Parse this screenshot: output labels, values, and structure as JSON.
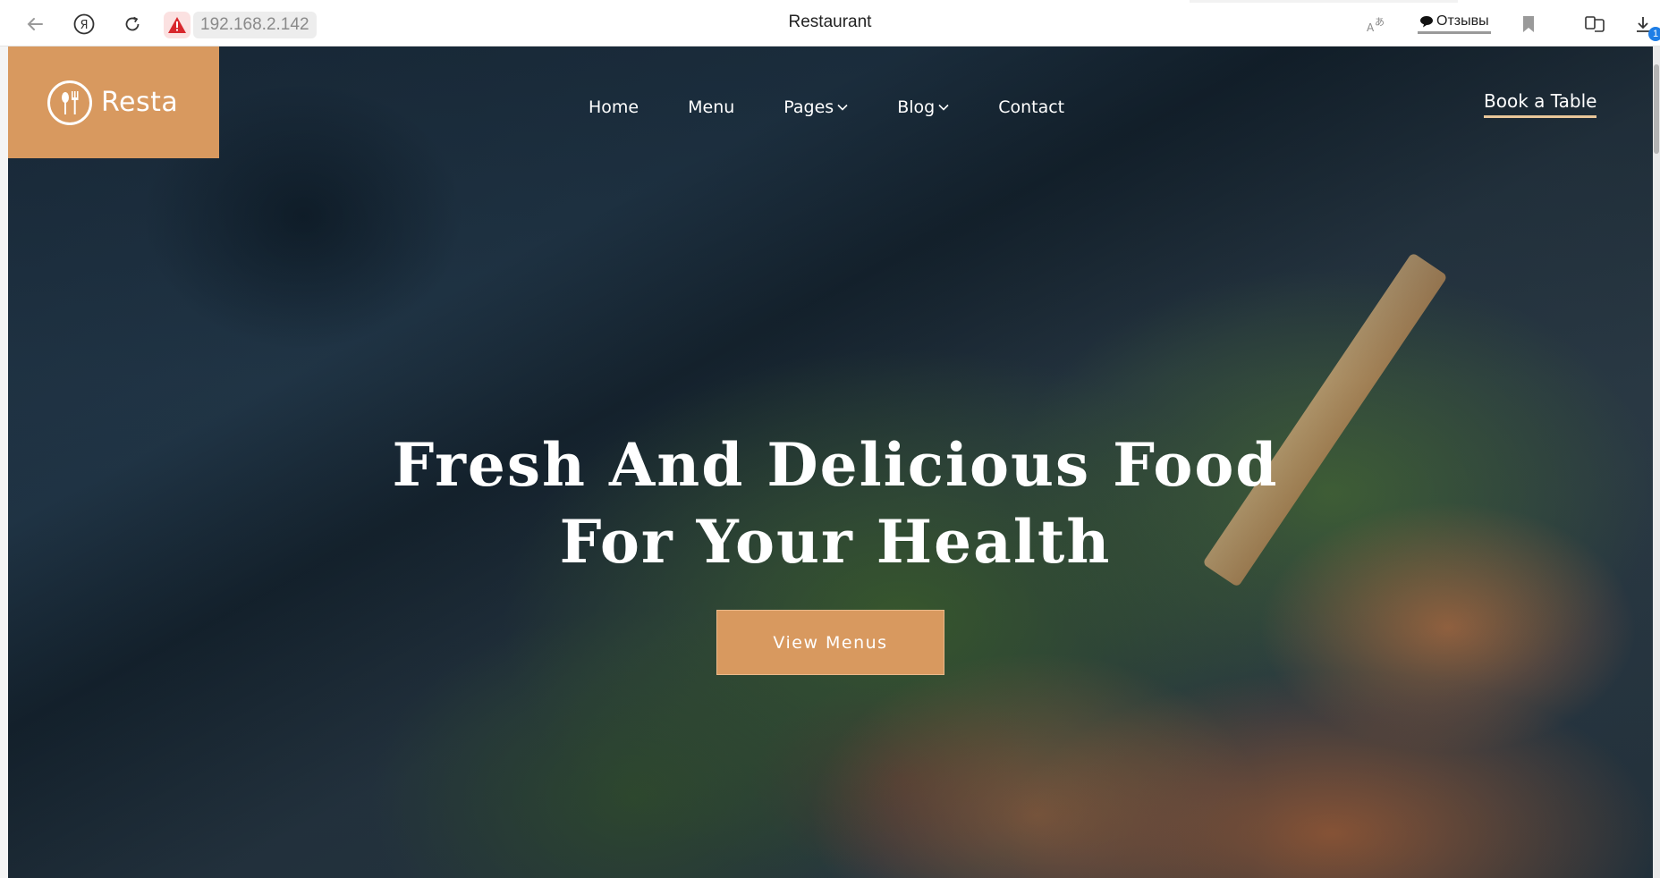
{
  "browser": {
    "tab_title": "Restaurant",
    "url": "192.168.2.142",
    "reviews_label": "Отзывы",
    "downloads_badge": "1",
    "icons": [
      "back-icon",
      "yandex-icon",
      "reload-icon",
      "warning-icon",
      "translate-icon",
      "comment-icon",
      "bookmark-icon",
      "mirror-icon",
      "download-icon"
    ]
  },
  "site": {
    "logo_text": "Resta",
    "nav": {
      "home": "Home",
      "menu": "Menu",
      "pages": "Pages",
      "blog": "Blog",
      "contact": "Contact"
    },
    "book_label": "Book a Table",
    "hero": {
      "line1": "Fresh And Delicious Food",
      "line2": "For Your Health",
      "cta_label": "View Menus"
    },
    "colors": {
      "accent": "#d8995f",
      "book_underline": "#e9c79a",
      "warning": "#d8262c"
    }
  }
}
